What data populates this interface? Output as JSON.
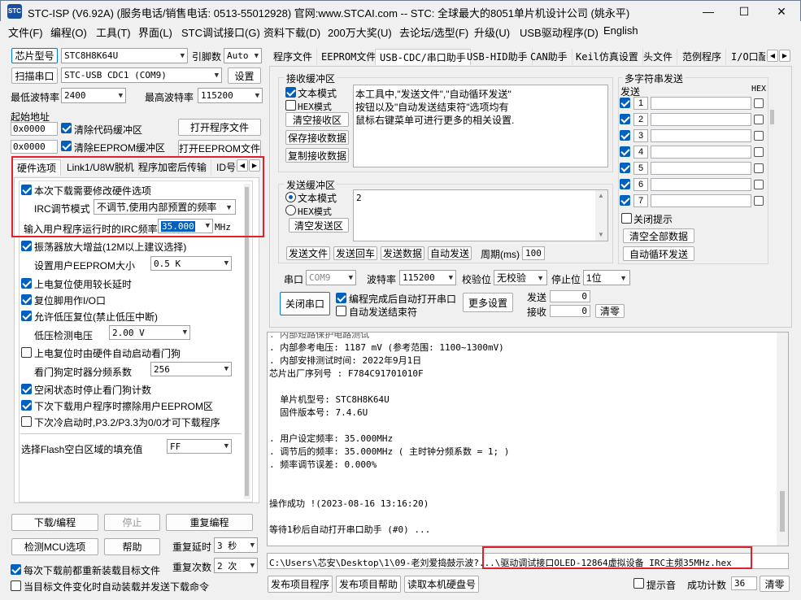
{
  "window": {
    "title": "STC-ISP (V6.92A) (服务电话/销售电话: 0513-55012928) 官网:www.STCAI.com  -- STC: 全球最大的8051单片机设计公司 (姚永平)",
    "app_icon": "STC",
    "minimize": "—",
    "maximize": "☐",
    "close": "✕"
  },
  "menu": [
    "文件(F)",
    "编程(O)",
    "工具(T)",
    "界面(L)",
    "STC调试接口(G)",
    "资料下载(D)",
    "200万大奖(U)",
    "去论坛/选型(F)",
    "升级(U)",
    "USB驱动程序(D)",
    "English"
  ],
  "left": {
    "chip_label": "芯片型号",
    "chip_value": "STC8H8K64U",
    "pin_label": "引脚数",
    "pin_value": "Auto",
    "scan_label": "扫描串口",
    "port_value": "STC-USB CDC1 (COM9)",
    "settings": "设置",
    "min_baud_label": "最低波特率",
    "min_baud": "2400",
    "max_baud_label": "最高波特率",
    "max_baud": "115200",
    "start_addr_label": "起始地址",
    "addr1": "0x0000",
    "addr2": "0x0000",
    "clear_code": "清除代码缓冲区",
    "clear_eeprom": "清除EEPROM缓冲区",
    "open_prog": "打开程序文件",
    "open_eeprom": "打开EEPROM文件",
    "tabs": [
      "硬件选项",
      "Link1/U8W脱机",
      "程序加密后传输",
      "ID号"
    ],
    "hw": {
      "modify_hw": "本次下载需要修改硬件选项",
      "irc_mode_label": "IRC调节模式",
      "irc_mode": "不调节,使用内部预置的频率",
      "freq_label": "输入用户程序运行时的IRC频率",
      "freq": "35.000",
      "mhz": "MHz",
      "osc_gain": "振荡器放大增益(12M以上建议选择)",
      "eeprom_size_label": "设置用户EEPROM大小",
      "eeprom_size": "0.5 K",
      "por_delay": "上电复位使用较长延时",
      "reset_io": "复位脚用作I/O口",
      "lvr": "允许低压复位(禁止低压中断)",
      "lvd_label": "低压检测电压",
      "lvd": "2.00 V",
      "wdt_auto": "上电复位时由硬件自动启动看门狗",
      "wdt_div_label": "看门狗定时器分频系数",
      "wdt_div": "256",
      "wdt_idle": "空闲状态时停止看门狗计数",
      "erase_eeprom": "下次下载用户程序时擦除用户EEPROM区",
      "p32p33": "下次冷启动时,P3.2/P3.3为0/0才可下载程序",
      "fill_label": "选择Flash空白区域的填充值",
      "fill": "FF"
    },
    "download": "下载/编程",
    "stop": "停止",
    "reprogram": "重复编程",
    "check_mcu": "检测MCU选项",
    "help": "帮助",
    "retry_delay_label": "重复延时",
    "retry_delay": "3 秒",
    "retry_count_label": "重复次数",
    "retry_count": "2 次",
    "reload": "每次下载前都重新装载目标文件",
    "auto_load": "当目标文件变化时自动装载并发送下载命令"
  },
  "right": {
    "tabs": [
      "程序文件",
      "EEPROM文件",
      "USB-CDC/串口助手",
      "USB-HID助手",
      "CAN助手",
      "Keil仿真设置",
      "头文件",
      "范例程序",
      "I/O口配"
    ],
    "recv": {
      "title": "接收缓冲区",
      "text_mode": "文本模式",
      "hex_mode": "HEX模式",
      "clear": "清空接收区",
      "save": "保存接收数据",
      "copy": "复制接收数据",
      "content": [
        "本工具中,\"发送文件\",\"自动循环发送\"",
        "按钮以及\"自动发送结束符\"选项均有",
        "鼠标右键菜单可进行更多的相关设置."
      ]
    },
    "multi": {
      "title": "多字符串发送",
      "send": "发送",
      "hex": "HEX",
      "rows": [
        "1",
        "2",
        "3",
        "4",
        "5",
        "6",
        "7"
      ],
      "close_tip": "关闭提示",
      "clear_all": "清空全部数据",
      "auto_loop": "自动循环发送"
    },
    "send": {
      "title": "发送缓冲区",
      "text_mode": "文本模式",
      "hex_mode": "HEX模式",
      "clear": "清空发送区",
      "content": "2",
      "send_file": "发送文件",
      "send_enter": "发送回车",
      "send_data": "发送数据",
      "auto_send": "自动发送",
      "period_label": "周期(ms)",
      "period": "100"
    },
    "port": {
      "port_label": "串口",
      "port": "COM9",
      "baud_label": "波特率",
      "baud": "115200",
      "parity_label": "校验位",
      "parity": "无校验",
      "stop_label": "停止位",
      "stop": "1位",
      "close_port": "关闭串口",
      "auto_open": "编程完成后自动打开串口",
      "auto_end": "自动发送结束符",
      "more": "更多设置",
      "tx_label": "发送",
      "tx": "0",
      "rx_label": "接收",
      "rx": "0",
      "clear": "清零"
    }
  },
  "log": [
    ". 内部参考电压: 1187 mV (参考范围: 1100~1300mV)",
    ". 内部安排测试时间: 2022年9月1日",
    "芯片出厂序列号 : F784C91701010F",
    "",
    "  单片机型号: STC8H8K64U",
    "  固件版本号: 7.4.6U",
    "",
    ". 用户设定频率: 35.000MHz",
    ". 调节后的频率: 35.000MHz ( 主时钟分频系数 = 1; )",
    ". 频率调节误差: 0.000%",
    "",
    "",
    "操作成功 !(2023-08-16 13:16:20)",
    "",
    "等待1秒后自动打开串口助手 (#0) ..."
  ],
  "path": "C:\\Users\\芯安\\Desktop\\1\\09-老刘爱捣鼓示波?...\\驱动调试接口OLED-12864虚拟设备_IRC主频35MHz.hex",
  "bottom": {
    "publish": "发布项目程序",
    "publish_help": "发布项目帮助",
    "read_serial": "读取本机硬盘号",
    "sound": "提示音",
    "success_label": "成功计数",
    "success": "36",
    "clear": "清零"
  },
  "accent": "#0060c0",
  "highlight": "#e0202a"
}
